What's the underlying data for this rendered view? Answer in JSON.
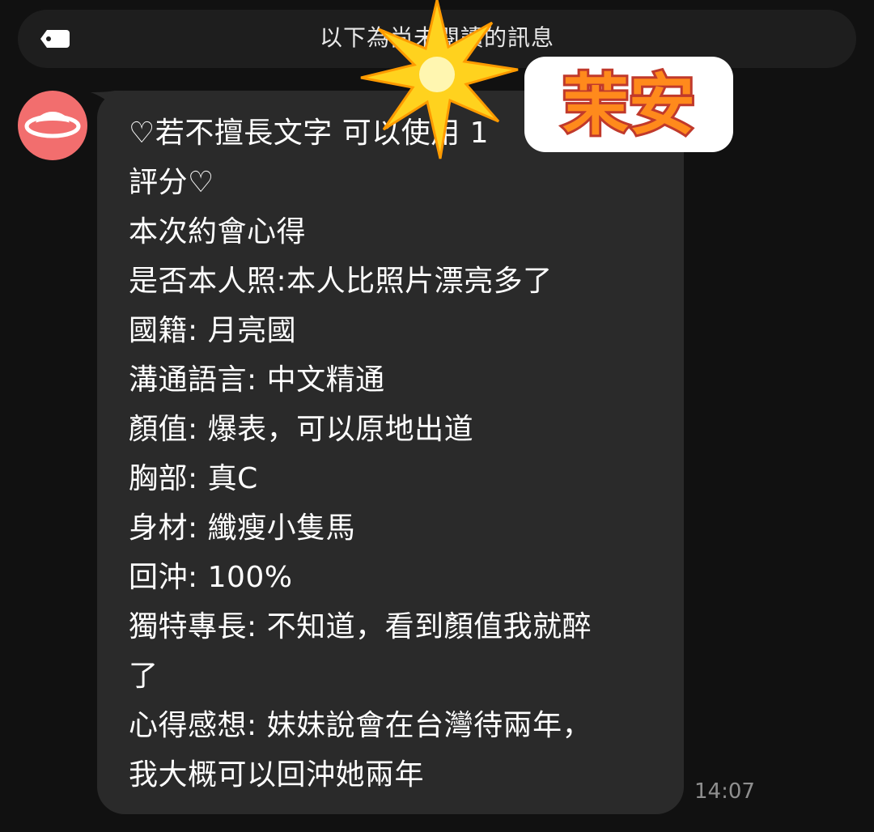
{
  "unread_banner": {
    "icon": "tag-icon",
    "text": "以下為尚未閱讀的訊息"
  },
  "sender": {
    "avatar_icon": "planet-icon",
    "avatar_color": "#f26e6e"
  },
  "message": {
    "lines": [
      "♡若不擅長文字 可以使用 1",
      "評分♡",
      "本次約會心得",
      "是否本人照:本人比照片漂亮多了",
      "國籍: 月亮國",
      "溝通語言: 中文精通",
      "顏值: 爆表，可以原地出道",
      "胸部: 真C",
      "身材: 纖瘦小隻馬",
      "回沖: 100%",
      "獨特專長: 不知道，看到顏值我就醉",
      "了",
      "心得感想: 妹妹說會在台灣待兩年，",
      "我大概可以回沖她兩年"
    ],
    "timestamp": "14:07"
  },
  "sticker": {
    "icon": "starburst-icon",
    "text": "茉安",
    "colors": {
      "star": "#ffd21e",
      "text": "#ff8a1c",
      "outline": "#c0392b"
    }
  },
  "colors": {
    "background": "#111111",
    "bubble": "#2a2a2a",
    "banner": "#1e1e1e",
    "timestamp": "#8f8f8f"
  }
}
